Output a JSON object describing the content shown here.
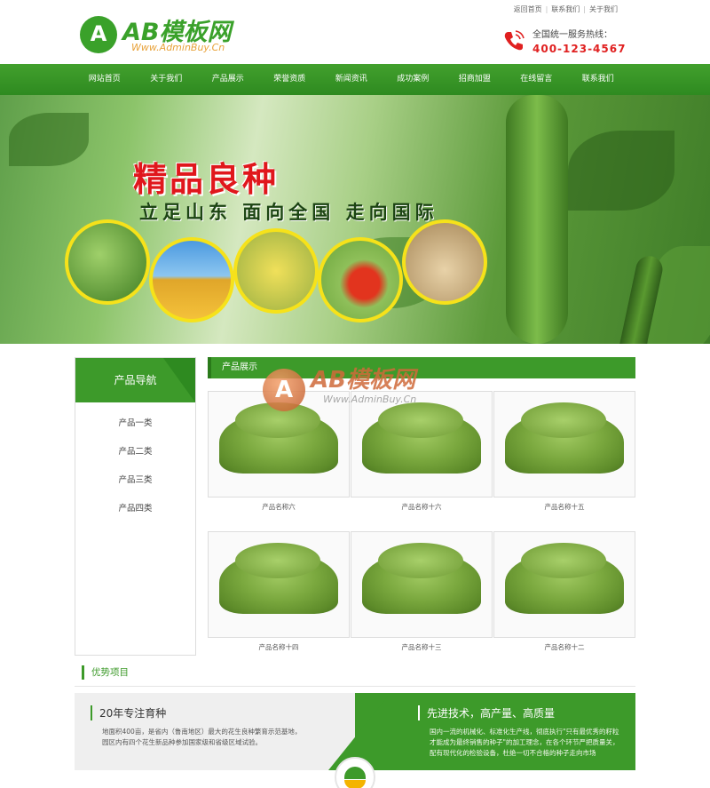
{
  "brand": {
    "logo_letter": "A",
    "title": "AB模板网",
    "url": "Www.AdminBuy.Cn",
    "accent_color": "#3d9a2a"
  },
  "toplinks": [
    "返回首页",
    "联系我们",
    "关于我们"
  ],
  "hotline": {
    "label": "全国统一服务热线：",
    "number": "400-123-4567",
    "icon": "phone-icon"
  },
  "nav": [
    "网站首页",
    "关于我们",
    "产品展示",
    "荣誉资质",
    "新闻资讯",
    "成功案例",
    "招商加盟",
    "在线留言",
    "联系我们"
  ],
  "banner": {
    "title": "精品良种",
    "slogan": "立足山东 面向全国 走向国际"
  },
  "sidebar": {
    "title": "产品导航",
    "items": [
      "产品一类",
      "产品二类",
      "产品三类",
      "产品四类"
    ]
  },
  "content": {
    "title": "产品展示",
    "products": [
      {
        "name": "产品名称六"
      },
      {
        "name": "产品名称十六"
      },
      {
        "name": "产品名称十五"
      },
      {
        "name": "产品名称十四"
      },
      {
        "name": "产品名称十三"
      },
      {
        "name": "产品名称十二"
      }
    ]
  },
  "watermark": {
    "letter": "A",
    "title": "AB模板网",
    "url": "Www.AdminBuy.Cn"
  },
  "advantages": {
    "title": "优势项目",
    "left": {
      "heading": "20年专注育种",
      "text": "地面积400亩，是省内（鲁南地区）最大的花生良种繁育示范基地，园区内有四个花生新品种参加国家级和省级区域试验。"
    },
    "right": {
      "heading": "先进技术，高产量、高质量",
      "text": "国内一流的机械化、标准化生产线，彻底执行\"只有最优秀的籽粒才能成为最终销售的种子\"的加工理念，在各个环节严把质量关，配有现代化的检验设备，杜绝一切不合格的种子走向市场"
    }
  }
}
